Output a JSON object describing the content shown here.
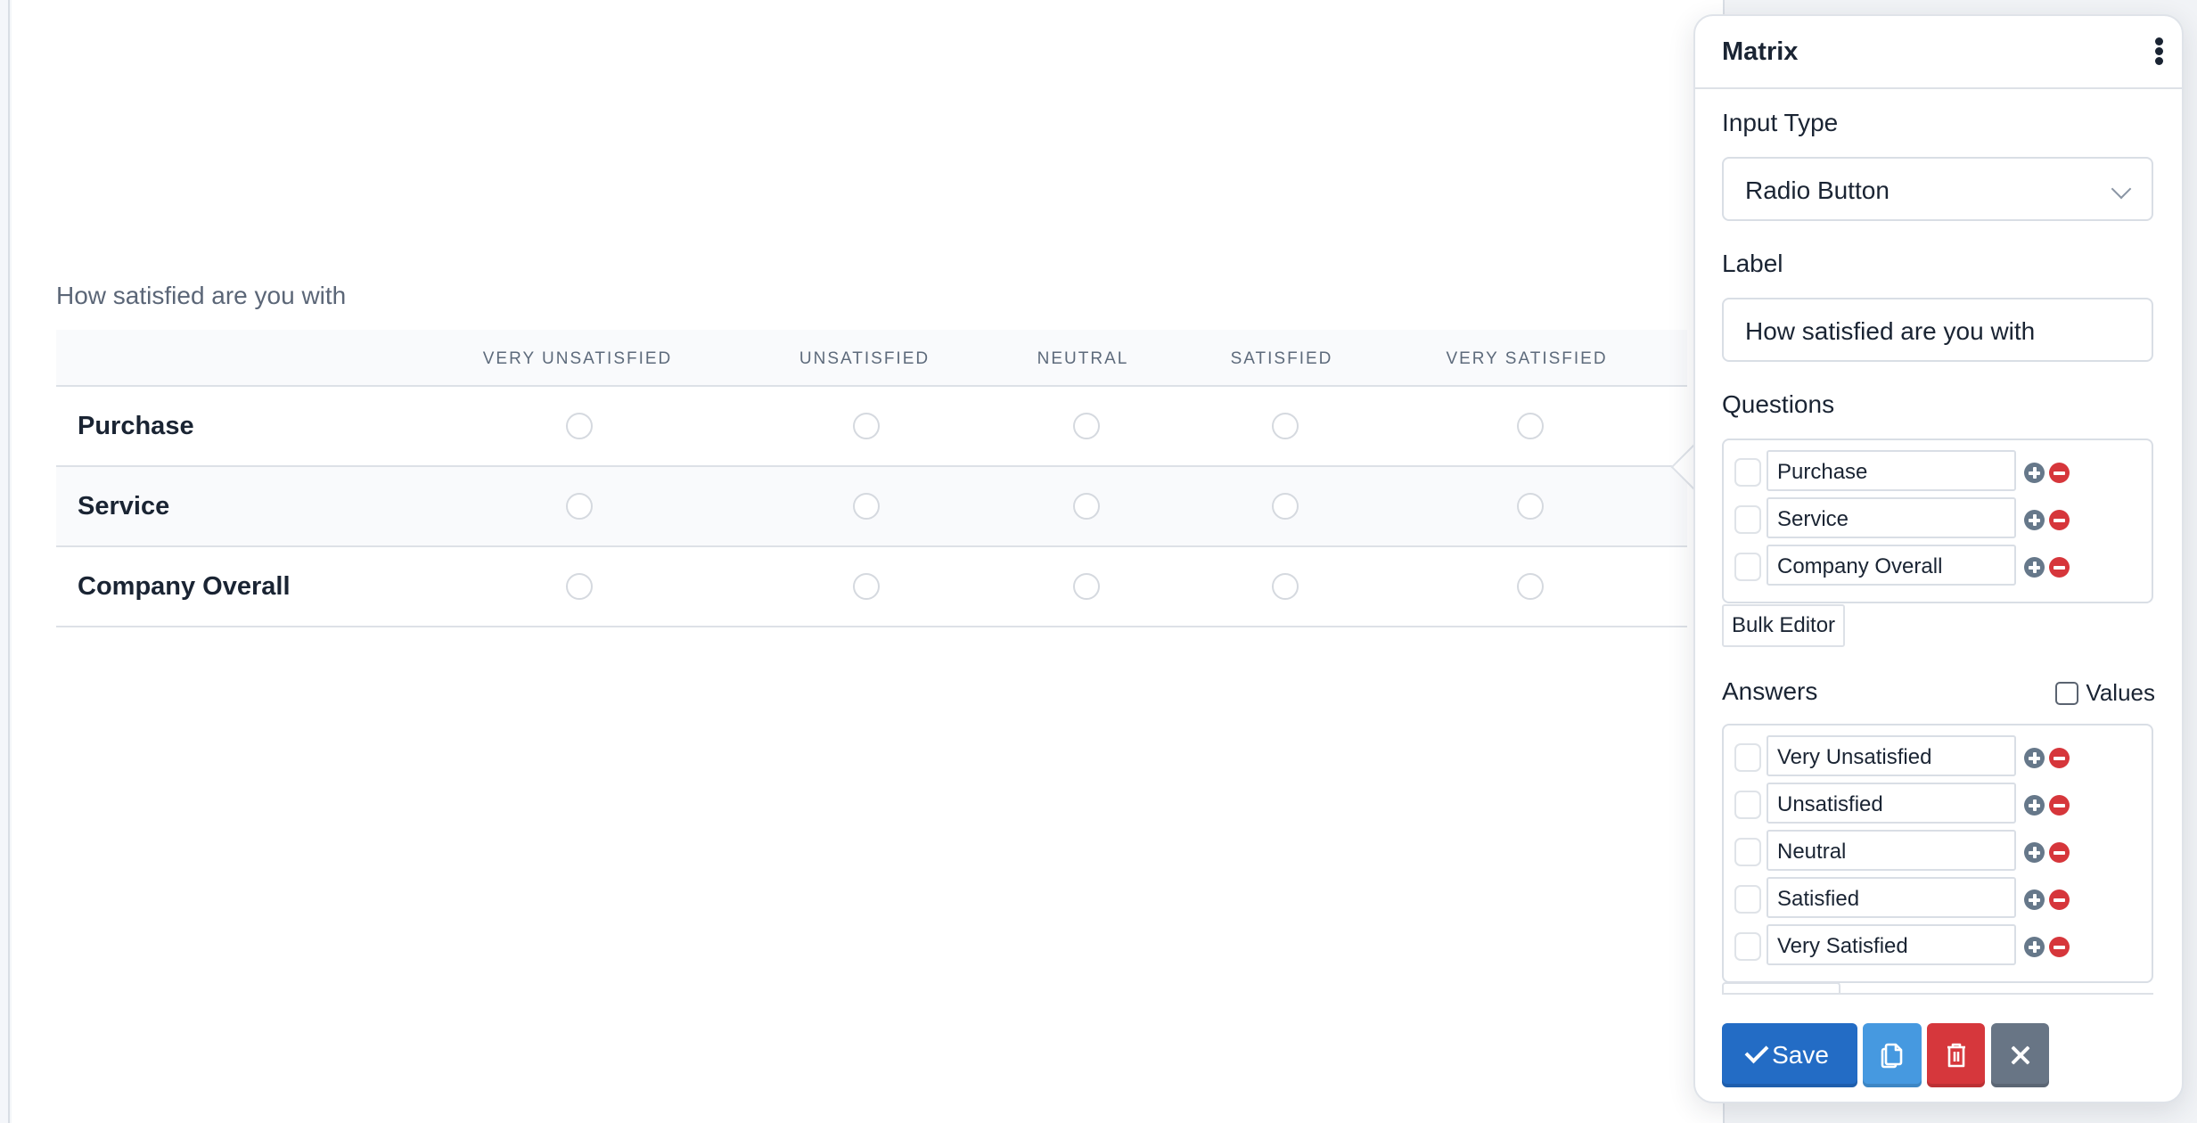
{
  "preview": {
    "question_label": "How satisfied are you with",
    "columns": [
      "VERY UNSATISFIED",
      "UNSATISFIED",
      "NEUTRAL",
      "SATISFIED",
      "VERY SATISFIED"
    ],
    "rows": [
      "Purchase",
      "Service",
      "Company Overall"
    ]
  },
  "panel": {
    "title": "Matrix",
    "menu_icon": "kebab-vertical-icon",
    "input_type": {
      "label": "Input Type",
      "selected": "Radio Button"
    },
    "label_field": {
      "label": "Label",
      "value": "How satisfied are you with"
    },
    "questions": {
      "label": "Questions",
      "items": [
        "Purchase",
        "Service",
        "Company Overall"
      ],
      "bulk_editor_label": "Bulk Editor"
    },
    "answers": {
      "label": "Answers",
      "values_toggle_label": "Values",
      "values_checked": false,
      "items": [
        "Very Unsatisfied",
        "Unsatisfied",
        "Neutral",
        "Satisfied",
        "Very Satisfied"
      ]
    },
    "actions": {
      "save_label": "Save",
      "copy_icon": "copy-icon",
      "delete_icon": "trash-icon",
      "close_icon": "close-icon"
    }
  },
  "colors": {
    "save": "#236cc5",
    "copy": "#4699e0",
    "delete": "#d6373c",
    "close": "#687585",
    "add_icon": "#66788a",
    "remove_icon": "#d6363b"
  }
}
